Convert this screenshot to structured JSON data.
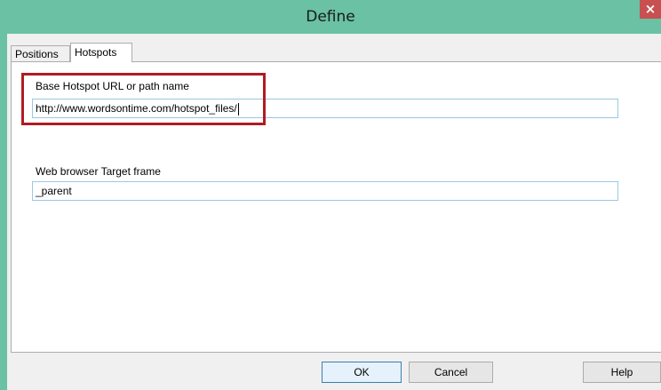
{
  "window": {
    "title": "Define",
    "close_glyph": "×"
  },
  "tabs": [
    {
      "label": "Positions",
      "active": false
    },
    {
      "label": "Hotspots",
      "active": true
    }
  ],
  "hotspots": {
    "base_url_label": "Base Hotspot URL or path name",
    "base_url_value": "http://www.wordsontime.com/hotspot_files/",
    "target_frame_label": "Web browser Target frame",
    "target_frame_value": "_parent"
  },
  "buttons": {
    "ok": "OK",
    "cancel": "Cancel",
    "help": "Help"
  },
  "colors": {
    "titlebar": "#6ac1a4",
    "close_button": "#c75050",
    "highlight_box": "#b01c22",
    "field_border": "#9ac8e4"
  }
}
